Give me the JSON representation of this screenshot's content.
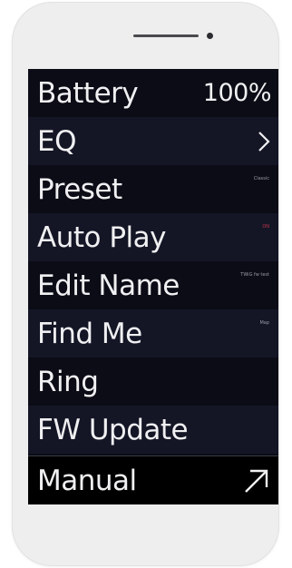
{
  "menu": {
    "battery": {
      "label": "Battery",
      "value": "100%"
    },
    "eq": {
      "label": "EQ",
      "icon": "chevron-right-icon"
    },
    "preset": {
      "label": "Preset",
      "value": "Classic"
    },
    "auto_play": {
      "label": "Auto Play",
      "value": "ON"
    },
    "edit_name": {
      "label": "Edit Name",
      "value": "TWiG fw test"
    },
    "find_me": {
      "label": "Find Me",
      "value": "Map"
    },
    "ring": {
      "label": "Ring"
    },
    "fw_update": {
      "label": "FW Update"
    },
    "manual": {
      "label": "Manual",
      "icon": "external-link-arrow-icon"
    }
  },
  "colors": {
    "screen_bg": "#0b0c16",
    "row_alt_bg": "#141626",
    "manual_bg": "#000000",
    "on_accent": "#c0344a",
    "phone_body": "#eeeeef"
  }
}
